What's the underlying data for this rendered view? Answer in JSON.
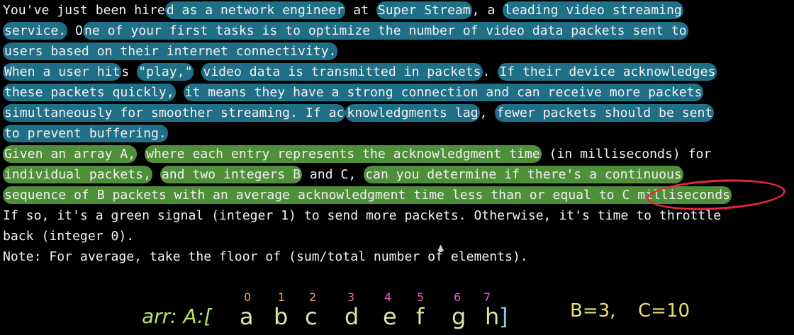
{
  "problem": {
    "p1_l1_a": "You've just been hire",
    "p1_l1_b": "d as a network engineer",
    "p1_l1_c": " at ",
    "p1_l1_d": "Super Stream",
    "p1_l1_e": ", a ",
    "p1_l1_f": "leading video streaming",
    "p1_l2_a": "service.",
    "p1_l2_b": " O",
    "p1_l2_c": "ne of your first tasks is to optimize the number of video data packets sent to",
    "p1_l3": "users based on their internet connectivity.",
    "p2_l1_a": "When a user hit",
    "p2_l1_b": "s ",
    "p2_l1_c": "\"play,\"",
    "p2_l1_d": " ",
    "p2_l1_e": "video data is transmitted in packets",
    "p2_l1_f": ". ",
    "p2_l1_g": "If their device acknowledges",
    "p2_l2_a": "these packets quickly,",
    "p2_l2_b": " ",
    "p2_l2_c": "it means they have a strong connection and can receive more packets",
    "p2_l3_a": "simultaneously for smoother streaming. If ac",
    "p2_l3_b": "knowledgments lag",
    "p2_l3_c": ", ",
    "p2_l3_d": "fewer packets should be sent",
    "p2_l4": "to prevent buffering.",
    "p3_l1_a": "Given an array A,",
    "p3_l1_b": " ",
    "p3_l1_c": "where each entry represents the acknowledgment time",
    "p3_l1_d": " (in milliseconds) for",
    "p3_l2_a": "individual packets,",
    "p3_l2_b": " ",
    "p3_l2_c": "and two integers B",
    "p3_l2_d": " and C,",
    "p3_l2_e": " ",
    "p3_l2_f": "can you determine if there's a continuous",
    "p3_l3_a": "sequence of B packets with an average acknowledgment time less than or equal to C milliseconds",
    "p4_l1": "If so, it's a green signal (integer 1) to send more packets. Otherwise, it's time to throttle",
    "p4_l2": "back (integer 0).",
    "p5_l1": "Note: For average, take the floor of (sum/total number of elements)."
  },
  "annotations": {
    "arr_label": "arr: A:[",
    "letters": [
      "a",
      "b",
      "c",
      "d",
      "e",
      "f",
      "g",
      "h"
    ],
    "close_bracket": "]",
    "indices": [
      "0",
      "1",
      "2",
      "3",
      "4",
      "5",
      "6",
      "7"
    ],
    "b_value": "B=3,",
    "c_value": "C=10"
  },
  "colors": {
    "highlight_blue": "#1f6f86",
    "highlight_green": "#4f8f3a",
    "circle_red": "#e6283a"
  }
}
